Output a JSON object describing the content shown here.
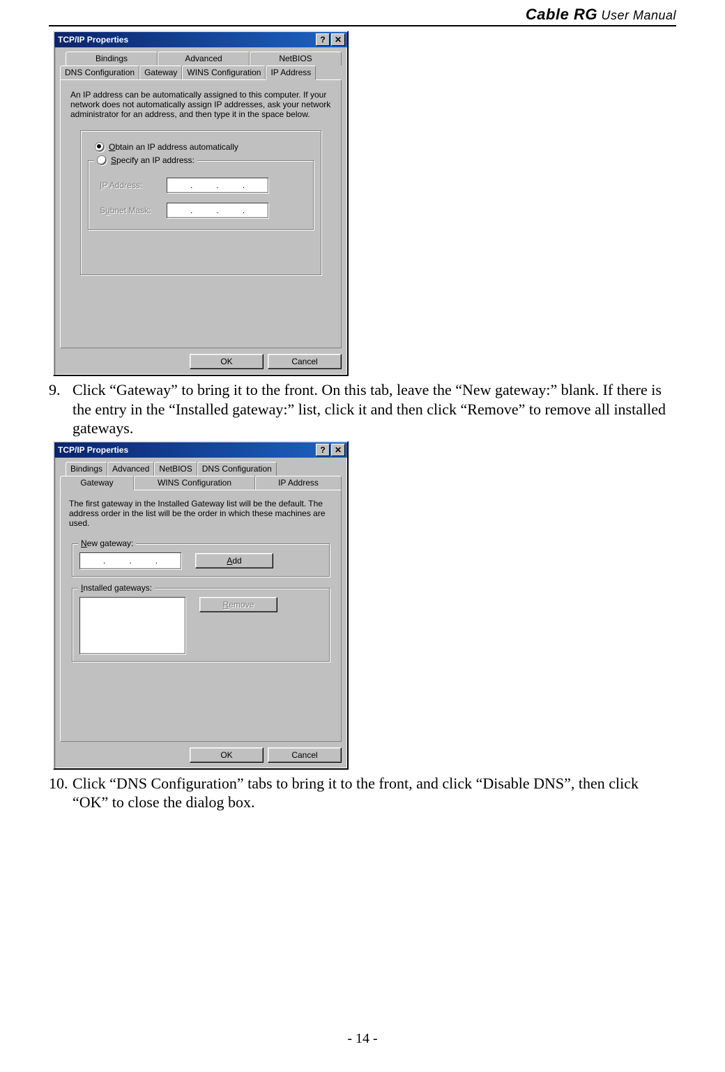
{
  "header": {
    "bold": "Cable RG",
    "thin": " User Manual"
  },
  "page_number": "- 14 -",
  "steps": {
    "nine": {
      "num": "9.",
      "text": "Click “Gateway” to bring it to the front. On this tab, leave the “New gateway:” blank. If there is the entry in the “Installed gateway:” list, click it and then click “Remove” to remove all installed gateways."
    },
    "ten": {
      "num": "10.",
      "text": "Click “DNS Configuration” tabs to bring it to the front, and click “Disable DNS”, then click “OK” to close the dialog box."
    }
  },
  "dialog1": {
    "title": "TCP/IP Properties",
    "help_btn": "?",
    "close_btn": "✕",
    "tabs_row1": [
      "Bindings",
      "Advanced",
      "NetBIOS"
    ],
    "tabs_row2": [
      "DNS Configuration",
      "Gateway",
      "WINS Configuration",
      "IP Address"
    ],
    "active_tab": "IP Address",
    "info_text": "An IP address can be automatically assigned to this computer. If your network does not automatically assign IP addresses, ask your network administrator for an address, and then type it in the space below.",
    "radio_auto_prefix": "O",
    "radio_auto_label": "btain an IP address automatically",
    "radio_spec_prefix": "S",
    "radio_spec_label": "pecify an IP address:",
    "ip_label_prefix": "I",
    "ip_label": "P Address:",
    "subnet_label_prefix": "S",
    "subnet_label_u": "u",
    "subnet_label_rest": "bnet Mask:",
    "ok": "OK",
    "cancel": "Cancel"
  },
  "dialog2": {
    "title": "TCP/IP Properties",
    "help_btn": "?",
    "close_btn": "✕",
    "tabs_row1": [
      "Bindings",
      "Advanced",
      "NetBIOS",
      "DNS Configuration"
    ],
    "tabs_row2": [
      "Gateway",
      "WINS Configuration",
      "IP Address"
    ],
    "active_tab": "Gateway",
    "info_text": "The first gateway in the Installed Gateway list will be the default. The address order in the list will be the order in which these machines are used.",
    "new_gw_prefix": "N",
    "new_gw_label": "ew gateway:",
    "add_btn_prefix": "A",
    "add_btn_rest": "dd",
    "installed_prefix": "I",
    "installed_label": "nstalled gateways:",
    "remove_btn_prefix": "R",
    "remove_btn_rest": "emove",
    "ok": "OK",
    "cancel": "Cancel"
  }
}
